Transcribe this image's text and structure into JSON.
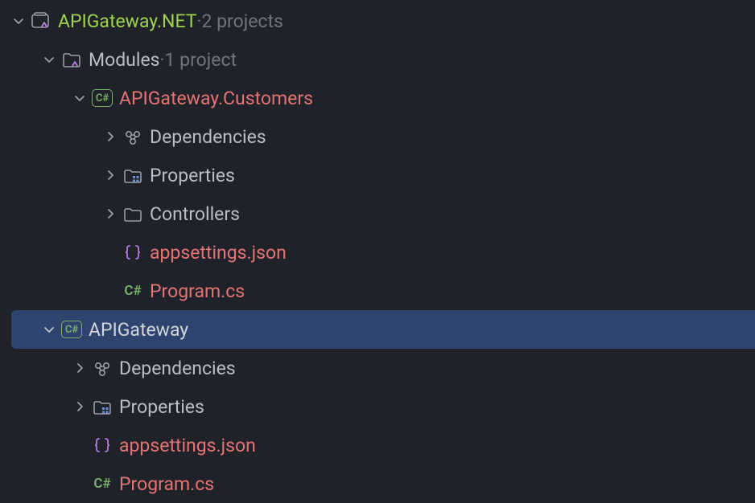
{
  "tree": {
    "solution": {
      "name": "APIGateway.NET",
      "meta": "2 projects"
    },
    "modules": {
      "name": "Modules",
      "meta": "1 project"
    },
    "project_customers": {
      "name": "APIGateway.Customers"
    },
    "deps1": {
      "name": "Dependencies"
    },
    "props1": {
      "name": "Properties"
    },
    "controllers": {
      "name": "Controllers"
    },
    "appsettings1": {
      "name": "appsettings.json"
    },
    "program1": {
      "name": "Program.cs"
    },
    "project_gateway": {
      "name": "APIGateway"
    },
    "deps2": {
      "name": "Dependencies"
    },
    "props2": {
      "name": "Properties"
    },
    "appsettings2": {
      "name": "appsettings.json"
    },
    "program2": {
      "name": "Program.cs"
    }
  },
  "icons": {
    "cs_badge": "C#",
    "cs_text": "C#",
    "sep": " · "
  }
}
